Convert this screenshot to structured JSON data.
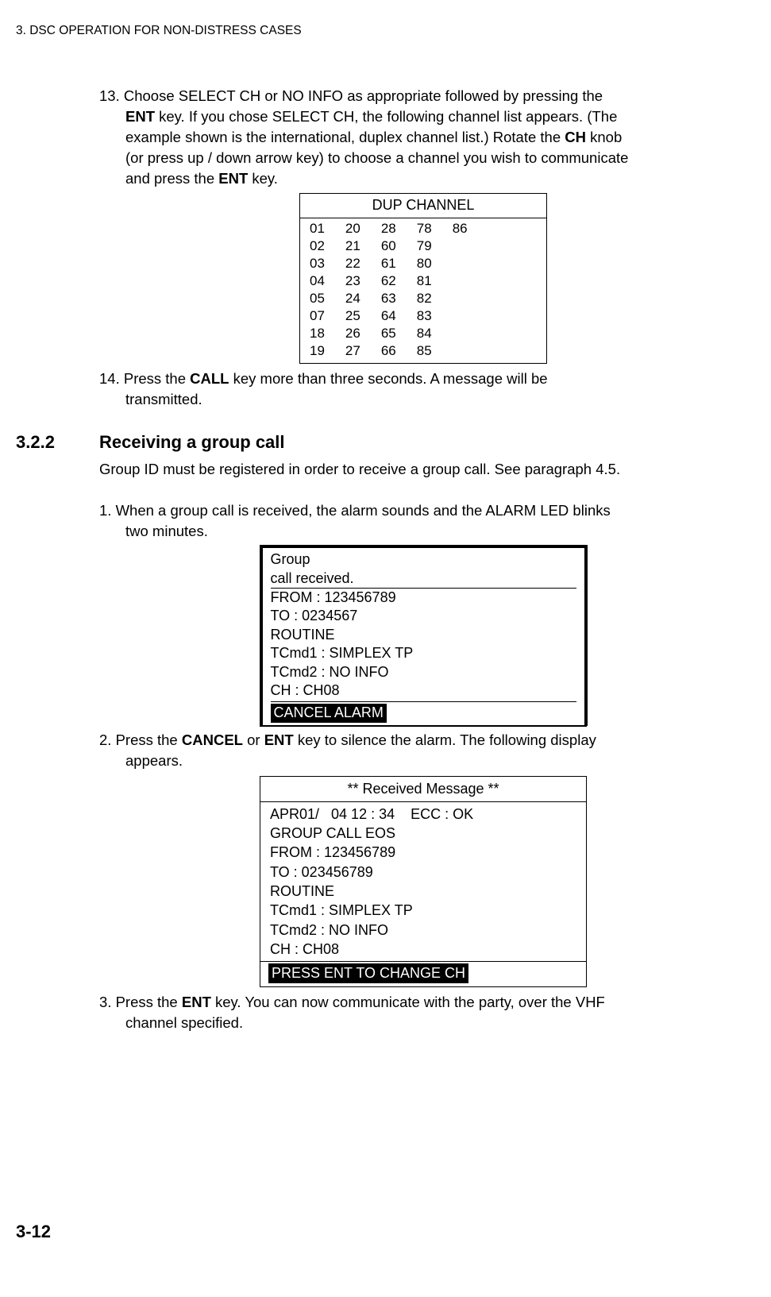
{
  "header": "3. DSC OPERATION FOR NON-DISTRESS CASES",
  "step13": {
    "num": "13. ",
    "line1": "Choose SELECT CH or NO INFO as appropriate followed by pressing the",
    "b1": "ENT",
    "line2a": " key. If you chose SELECT CH, the following channel list appears. (The",
    "line3": "example shown is the international, duplex channel list.) Rotate the ",
    "b2": "CH",
    "line3b": " knob",
    "line4": "(or press up / down arrow key) to choose a channel you wish to communicate",
    "line5a": "and press the ",
    "b3": "ENT",
    "line5b": " key."
  },
  "dup": {
    "title": "DUP CHANNEL",
    "c1": [
      "01",
      "02",
      "03",
      "04",
      "05",
      "07",
      "18",
      "19"
    ],
    "c2": [
      "20",
      "21",
      "22",
      "23",
      "24",
      "25",
      "26",
      "27"
    ],
    "c3": [
      "28",
      "60",
      "61",
      "62",
      "63",
      "64",
      "65",
      "66"
    ],
    "c4": [
      "78",
      "79",
      "80",
      "81",
      "82",
      "83",
      "84",
      "85"
    ],
    "c5": [
      "86"
    ]
  },
  "step14": {
    "num": "14. ",
    "l1a": "Press the ",
    "b": "CALL",
    "l1b": " key more than three seconds. A message will be",
    "l2": "transmitted."
  },
  "sec": {
    "num": "3.2.2",
    "title": "Receiving a group call"
  },
  "intro": "Group ID must be registered in order to receive a group call. See paragraph 4.5.",
  "step1": {
    "num": "1. ",
    "l1": "When a group call is received, the alarm sounds and the ALARM LED blinks",
    "l2": "two minutes."
  },
  "box1": {
    "h1": "Group",
    "h2": "call received.",
    "b": [
      "FROM : 123456789",
      "TO : 0234567",
      "ROUTINE",
      "TCmd1 : SIMPLEX TP",
      "TCmd2 : NO INFO",
      "CH : CH08"
    ],
    "btn": "CANCEL ALARM"
  },
  "step2": {
    "num": "2. ",
    "a": "Press the ",
    "b1": "CANCEL",
    "mid": " or ",
    "b2": "ENT",
    "c": " key to silence the alarm. The following display",
    "l2": "appears."
  },
  "box2": {
    "title": "** Received Message **",
    "row1": "APR01/   04 12 : 34    ECC : OK",
    "b": [
      "GROUP CALL EOS",
      "FROM : 123456789",
      "TO : 023456789",
      "ROUTINE",
      "TCmd1 : SIMPLEX TP",
      "TCmd2 : NO INFO",
      "CH : CH08"
    ],
    "btn": "PRESS ENT TO CHANGE CH"
  },
  "step3": {
    "num": "3. ",
    "a": "Press the ",
    "b": "ENT",
    "c": " key. You can now communicate with the party, over the ",
    "vhf": "VHF",
    "l2": "channel specified."
  },
  "pagenum": "3-12"
}
